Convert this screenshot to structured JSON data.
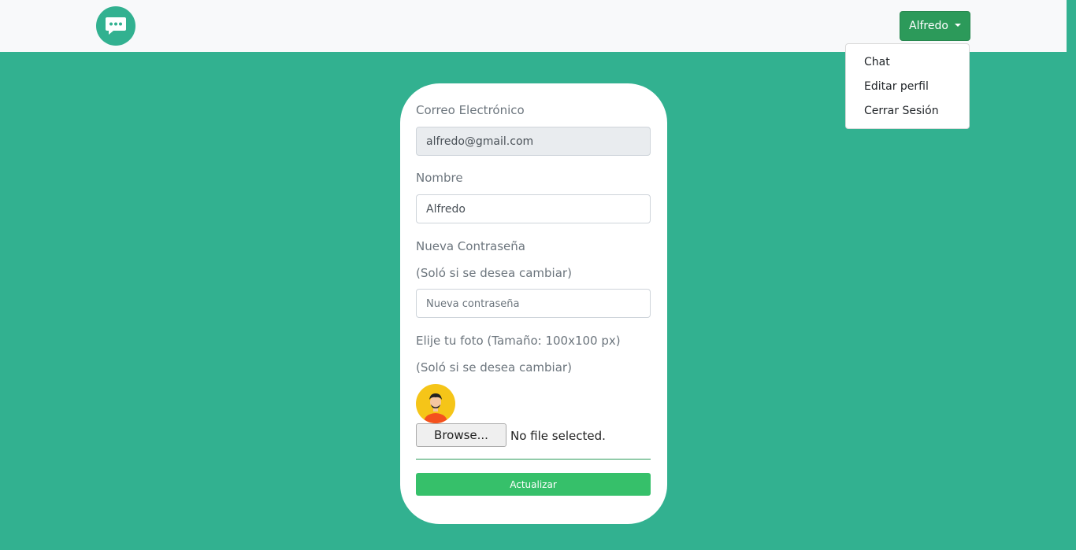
{
  "navbar": {
    "logo_icon": "chat-bubble-icon",
    "user_menu": {
      "label": "Alfredo",
      "items": [
        "Chat",
        "Editar perfil",
        "Cerrar Sesión"
      ]
    }
  },
  "form": {
    "email": {
      "label": "Correo Electrónico",
      "value": "alfredo@gmail.com"
    },
    "name": {
      "label": "Nombre",
      "value": "Alfredo"
    },
    "password": {
      "label": "Nueva Contraseña",
      "hint": "(Soló si se desea cambiar)",
      "placeholder": "Nueva contraseña"
    },
    "photo": {
      "label": "Elije tu foto (Tamaño: 100x100 px)",
      "hint": "(Soló si se desea cambiar)",
      "browse_label": "Browse...",
      "file_status": "No file selected."
    },
    "submit_label": "Actualizar"
  },
  "colors": {
    "background": "#32b190",
    "primary_button": "#2c9a5a",
    "submit_button": "#36c06a"
  }
}
